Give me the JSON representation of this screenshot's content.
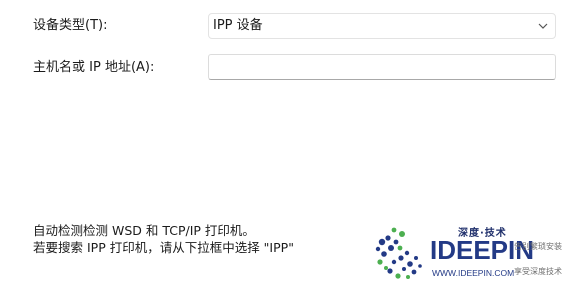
{
  "form": {
    "device_type_label": "设备类型(T):",
    "device_type_value": "IPP 设备",
    "host_label": "主机名或 IP 地址(A):",
    "host_value": ""
  },
  "info": {
    "line1": "自动检测检测 WSD 和 TCP/IP 打印机。",
    "line2": "若要搜索 IPP 打印机，请从下拉框中选择 \"IPP\""
  },
  "watermark": {
    "top_text": "深度·技术",
    "brand": "IDEEPIN",
    "url": "WWW.IDEEPIN.COM",
    "side_line1": "告别繁琐安装",
    "side_line2": "享受深度技术"
  },
  "colors": {
    "brand_blue": "#233a86",
    "logo_green": "#4caf50"
  },
  "icons": {
    "dropdown": "chevron-down-icon",
    "logo": "ideepin-logo-icon"
  }
}
